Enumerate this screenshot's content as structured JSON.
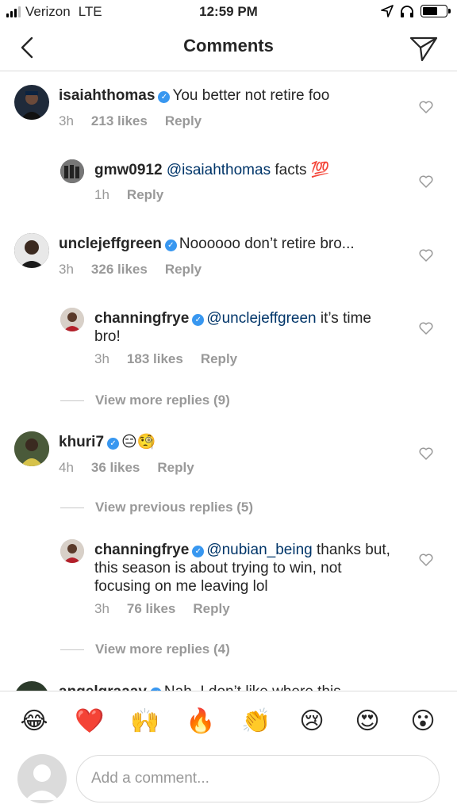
{
  "status_bar": {
    "carrier": "Verizon",
    "network": "LTE",
    "time": "12:59 PM"
  },
  "nav": {
    "title": "Comments"
  },
  "comments": [
    {
      "user": "isaiahthomas",
      "verified": true,
      "mention": "",
      "text": "You better not retire foo",
      "time": "3h",
      "likes": "213 likes",
      "reply": "Reply"
    },
    {
      "user": "gmw0912",
      "verified": false,
      "mention": "@isaiahthomas",
      "text": "facts 💯",
      "time": "1h",
      "likes": "",
      "reply": "Reply"
    },
    {
      "user": "unclejeffgreen",
      "verified": true,
      "mention": "",
      "text": "Noooooo don’t retire bro...",
      "time": "3h",
      "likes": "326 likes",
      "reply": "Reply"
    },
    {
      "user": "channingfrye",
      "verified": true,
      "mention": "@unclejeffgreen",
      "text": "it’s time bro!",
      "time": "3h",
      "likes": "183 likes",
      "reply": "Reply"
    },
    {
      "user": "khuri7",
      "verified": true,
      "mention": "",
      "text": "😑🧐",
      "time": "4h",
      "likes": "36 likes",
      "reply": "Reply"
    },
    {
      "user": "channingfrye",
      "verified": true,
      "mention": "@nubian_being",
      "text": "thanks but, this season is about trying to win, not focusing on me leaving lol",
      "time": "3h",
      "likes": "76 likes",
      "reply": "Reply"
    },
    {
      "user": "angelgraaay",
      "verified": true,
      "mention": "",
      "text": "Nah, I don’t like where this",
      "time": "",
      "likes": "",
      "reply": ""
    }
  ],
  "view_more_1": "View more replies (9)",
  "view_previous": "View previous replies (5)",
  "view_more_2": "View more replies (4)",
  "emojis": [
    "😂",
    "❤️",
    "🙌",
    "🔥",
    "👏",
    "😢",
    "😍",
    "😮"
  ],
  "composer": {
    "placeholder": "Add a comment..."
  },
  "icons": {
    "back": "chevron-left-icon",
    "send": "paper-plane-icon",
    "like": "heart-icon"
  },
  "colors": {
    "verified": "#3897f0",
    "mention": "#003569",
    "meta": "#999999",
    "divider": "#dbdbdb"
  }
}
